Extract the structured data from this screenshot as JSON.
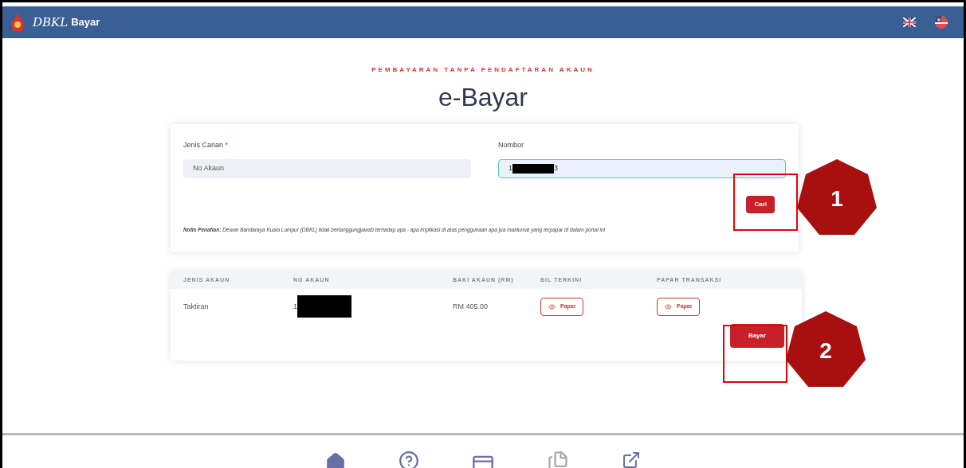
{
  "header": {
    "brand_script": "DBKL",
    "brand_name": "Bayar"
  },
  "eyebrow": "PEMBAYARAN TANPA PENDAFTARAN AKAUN",
  "title": "e-Bayar",
  "search_form": {
    "type_label": "Jenis Carian",
    "required_mark": "*",
    "type_value": "No Akaun",
    "number_label": "Nombor",
    "number_start": "1",
    "number_end": "3",
    "search_button": "Cari",
    "notice_label": "Notis Penafian:",
    "notice_text": "Dewan Bandaraya Kuala Lumpur (DBKL) tidak bertanggungjawab terhadap apa - apa implikasi di atas penggunaan apa jua maklumat yang terpapar di dalam portal ini"
  },
  "results": {
    "columns": [
      "JENIS AKAUN",
      "NO AKAUN",
      "BAKI AKAUN (RM)",
      "BIL TERKINI",
      "PAPAR TRANSAKSI"
    ],
    "rows": [
      {
        "type": "Taktiran",
        "account_start": "1",
        "balance": "RM 405.00",
        "bill_button": "Papar",
        "transactions_button": "Papar"
      }
    ],
    "pay_button": "Bayar"
  },
  "callouts": [
    "1",
    "2"
  ]
}
